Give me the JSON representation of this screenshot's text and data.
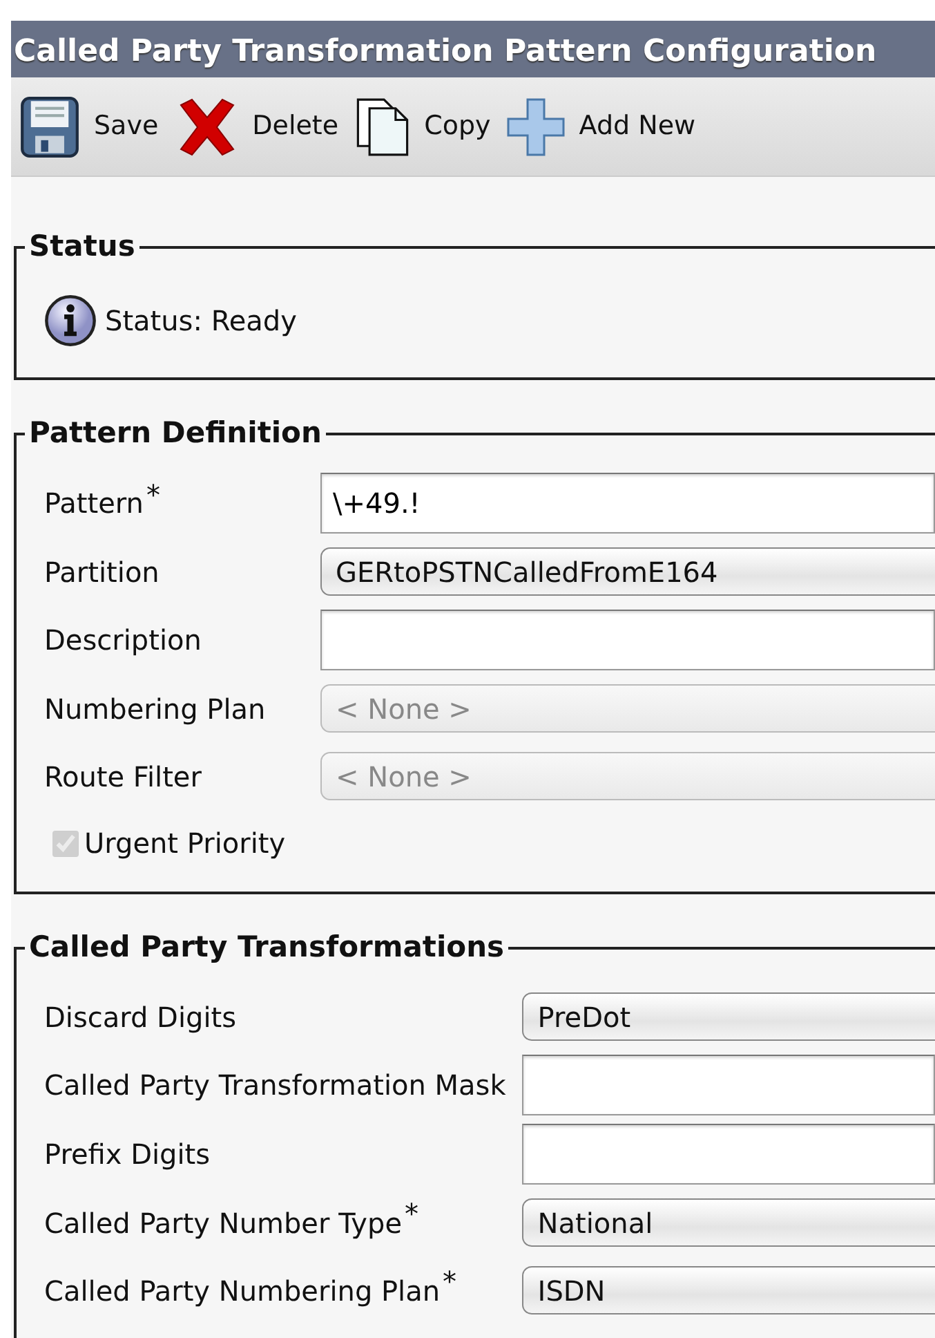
{
  "window": {
    "title": "Called Party Transformation Pattern Configuration"
  },
  "toolbar": [
    {
      "kind": "save",
      "label": "Save"
    },
    {
      "kind": "delete",
      "label": "Delete"
    },
    {
      "kind": "copy",
      "label": "Copy"
    },
    {
      "kind": "add",
      "label": "Add New"
    }
  ],
  "sections": [
    {
      "title": "Status",
      "status": {
        "text": "Status: Ready"
      }
    },
    {
      "title": "Pattern Definition",
      "fields": [
        {
          "kind": "text",
          "label": "Pattern",
          "required_mark": "*",
          "value": "\\+49.!"
        },
        {
          "kind": "select",
          "label": "Partition",
          "value": "GERtoPSTNCalledFromE164",
          "disabled": false
        },
        {
          "kind": "text",
          "label": "Description"
        },
        {
          "kind": "select",
          "label": "Numbering Plan",
          "value": "< None >",
          "disabled": true
        },
        {
          "kind": "select",
          "label": "Route Filter",
          "value": "< None >",
          "disabled": true
        }
      ],
      "checkbox": {
        "label": "Urgent Priority",
        "checked": true,
        "disabled": true
      }
    },
    {
      "title": "Called Party Transformations",
      "fields": [
        {
          "kind": "select",
          "label": "Discard Digits",
          "value": "PreDot",
          "disabled": false
        },
        {
          "kind": "text",
          "label": "Called Party Transformation Mask"
        },
        {
          "kind": "text",
          "label": "Prefix Digits"
        },
        {
          "kind": "select",
          "label": "Called Party Number Type",
          "required_mark": "*",
          "value": "National",
          "disabled": false
        },
        {
          "kind": "select",
          "label": "Called Party Numbering Plan",
          "required_mark": "*",
          "value": "ISDN",
          "disabled": false
        }
      ]
    }
  ]
}
